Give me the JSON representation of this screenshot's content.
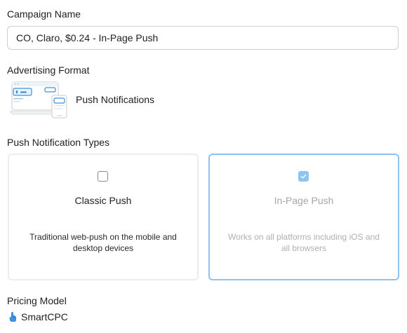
{
  "campaign_name": {
    "label": "Campaign Name",
    "value": "CO, Claro, $0.24 - In-Page Push"
  },
  "advertising_format": {
    "label": "Advertising Format",
    "icon": "push-notifications-illustration-icon",
    "value": "Push Notifications"
  },
  "push_notification_types": {
    "label": "Push Notification Types",
    "options": [
      {
        "title": "Classic Push",
        "description": "Traditional web-push on the mobile and desktop devices",
        "checked": false
      },
      {
        "title": "In-Page Push",
        "description": "Works on all platforms including iOS and all browsers",
        "checked": true
      }
    ]
  },
  "pricing_model": {
    "label": "Pricing Model",
    "icon": "pointer-hand-icon",
    "value": "SmartCPC"
  },
  "colors": {
    "selected_border": "#8cc3f2",
    "checkbox_checked": "#8ec4f0",
    "accent_blue": "#3d8fe0"
  }
}
